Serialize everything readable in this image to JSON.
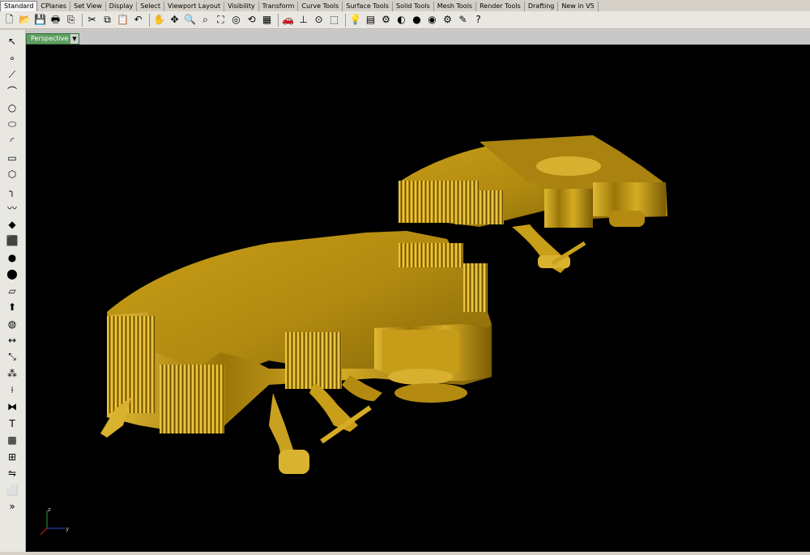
{
  "tabs": [
    "Standard",
    "CPlanes",
    "Set View",
    "Display",
    "Select",
    "Viewport Layout",
    "Visibility",
    "Transform",
    "Curve Tools",
    "Surface Tools",
    "Solid Tools",
    "Mesh Tools",
    "Render Tools",
    "Drafting",
    "New in V5"
  ],
  "toolbar_icons": [
    "new-icon",
    "open-icon",
    "save-icon",
    "print-icon",
    "import-icon",
    "cut-icon",
    "copy-icon",
    "paste-icon",
    "undo-icon",
    "pan-icon",
    "move-view-icon",
    "zoom-icon",
    "zoom-window-icon",
    "zoom-extents-icon",
    "zoom-selected-icon",
    "rotate-view-icon",
    "four-views-icon",
    "car-icon",
    "ortho-icon",
    "osnap-icon",
    "select-icon",
    "light-icon",
    "layer-icon",
    "properties-icon",
    "color-icon",
    "render-icon",
    "sphere-icon",
    "settings-icon",
    "options-icon",
    "help-icon"
  ],
  "left_icons": [
    "select-arrow-icon",
    "point-icon",
    "polyline-icon",
    "curve-icon",
    "circle-icon",
    "ellipse-icon",
    "arc-icon",
    "rectangle-icon",
    "polygon-icon",
    "fillet-icon",
    "freeform-icon",
    "surface-icon",
    "box-icon",
    "sphere-icon",
    "cylinder-icon",
    "plane-icon",
    "extrude-icon",
    "boolean-icon",
    "dimension-icon",
    "transform-icon",
    "array-icon",
    "split-icon",
    "join-icon",
    "text-icon",
    "mesh-icon",
    "group-icon",
    "mirror-icon",
    "cube-icon",
    "more-icon"
  ],
  "viewport": {
    "label": "Perspective",
    "model_color": "#c8a018"
  },
  "axes": {
    "x": "x",
    "y": "y",
    "z": "z"
  }
}
